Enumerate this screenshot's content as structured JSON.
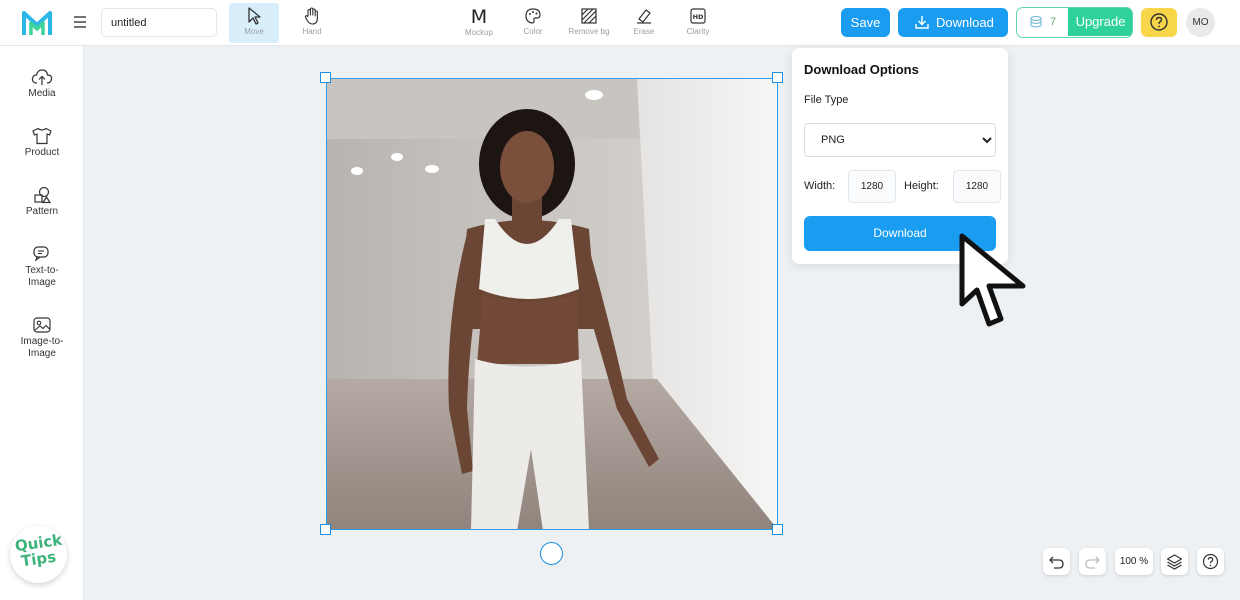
{
  "header": {
    "document_title": "untitled",
    "tools": [
      {
        "label": "Move",
        "icon": "cursor-arrow-icon",
        "active": true
      },
      {
        "label": "Hand",
        "icon": "hand-icon",
        "active": false
      },
      {
        "label": "Mockup",
        "icon": "mockup-m-icon",
        "glyph": "M",
        "active": false
      },
      {
        "label": "Color",
        "icon": "palette-icon",
        "active": false
      },
      {
        "label": "Remove bg",
        "icon": "remove-bg-icon",
        "active": false
      },
      {
        "label": "Erase",
        "icon": "eraser-icon",
        "active": false
      },
      {
        "label": "Clarity",
        "icon": "hd-icon",
        "glyph": "HD",
        "active": false
      }
    ],
    "save_label": "Save",
    "download_label": "Download",
    "credits": "7",
    "upgrade_label": "Upgrade",
    "help_icon": "question-circle-icon",
    "avatar_initials": "MO",
    "colors": {
      "primary": "#1a9cf0",
      "upgrade": "#2fd39a",
      "help": "#f7d64a"
    }
  },
  "sidebar": {
    "items": [
      {
        "label": "Media",
        "icon": "cloud-upload-icon"
      },
      {
        "label": "Product",
        "icon": "tshirt-icon"
      },
      {
        "label": "Pattern",
        "icon": "shapes-icon"
      },
      {
        "label": "Text-to-Image",
        "line1": "Text-to-",
        "line2": "Image",
        "icon": "chat-bubbles-icon"
      },
      {
        "label": "Image-to-Image",
        "line1": "Image-to-",
        "line2": "Image",
        "icon": "image-icon"
      }
    ],
    "quick_tips": {
      "line1": "Quick",
      "line2": "Tips"
    }
  },
  "canvas": {
    "image_subject": "woman-in-white-athletic-wear-photo"
  },
  "download_panel": {
    "title": "Download Options",
    "file_type_label": "File Type",
    "file_type_value": "PNG",
    "width_label": "Width:",
    "width_value": "1280",
    "height_label": "Height:",
    "height_value": "1280",
    "button_label": "Download"
  },
  "bottom_tools": {
    "zoom": "100 %",
    "undo_icon": "undo-icon",
    "redo_icon": "redo-icon",
    "layers_icon": "layers-icon",
    "help_icon": "question-circle-icon"
  }
}
